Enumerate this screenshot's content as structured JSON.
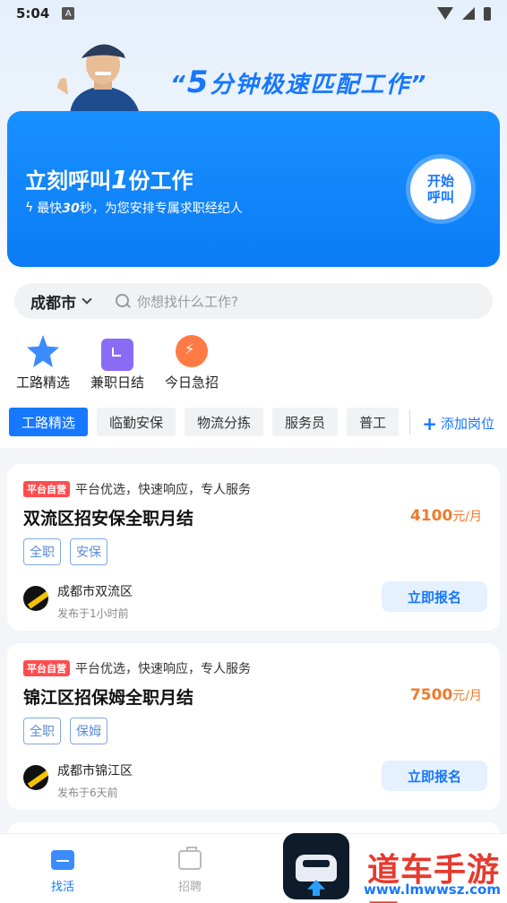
{
  "status_bar": {
    "time": "5:04",
    "indicator": "A"
  },
  "hero": {
    "slogan_open": "“",
    "slogan_num": "5",
    "slogan_text": "分钟极速匹配工作",
    "slogan_close": "”",
    "card_title_pre": "立刻呼叫",
    "card_title_num": "1",
    "card_title_post": "份工作",
    "card_sub_pre": "最快",
    "card_sub_num": "30",
    "card_sub_post": "秒，为您安排专属求职经纪人",
    "call_button": "开始\n呼叫"
  },
  "search": {
    "city": "成都市",
    "placeholder": "你想找什么工作?"
  },
  "quick_entries": [
    {
      "label": "工路精选",
      "icon": "star-icon"
    },
    {
      "label": "兼职日结",
      "icon": "calendar-icon"
    },
    {
      "label": "今日急招",
      "icon": "urgent-clock-icon"
    }
  ],
  "tabs": [
    "工路精选",
    "临勤安保",
    "物流分拣",
    "服务员",
    "普工"
  ],
  "add_post": "添加岗位",
  "jobs": [
    {
      "badge": "平台自营",
      "tagline": "平台优选，快速响应，专人服务",
      "title": "双流区招安保全职月结",
      "salary": "4100",
      "salary_unit": "元/月",
      "tags": [
        "全职",
        "安保"
      ],
      "location": "成都市双流区",
      "posted": "发布于1小时前",
      "apply": "立即报名"
    },
    {
      "badge": "平台自营",
      "tagline": "平台优选，快速响应，专人服务",
      "title": "锦江区招保姆全职月结",
      "salary": "7500",
      "salary_unit": "元/月",
      "tags": [
        "全职",
        "保姆"
      ],
      "location": "成都市锦江区",
      "posted": "发布于6天前",
      "apply": "立即报名"
    }
  ],
  "bottom_nav": [
    {
      "label": "找活",
      "active": true
    },
    {
      "label": "招聘",
      "active": false
    }
  ],
  "watermark": {
    "text": "道车手游网",
    "url": "www.lmwwsz.com"
  },
  "colors": {
    "primary": "#1677ff",
    "salary": "#f07a2b",
    "badge": "#ff4d4f"
  }
}
